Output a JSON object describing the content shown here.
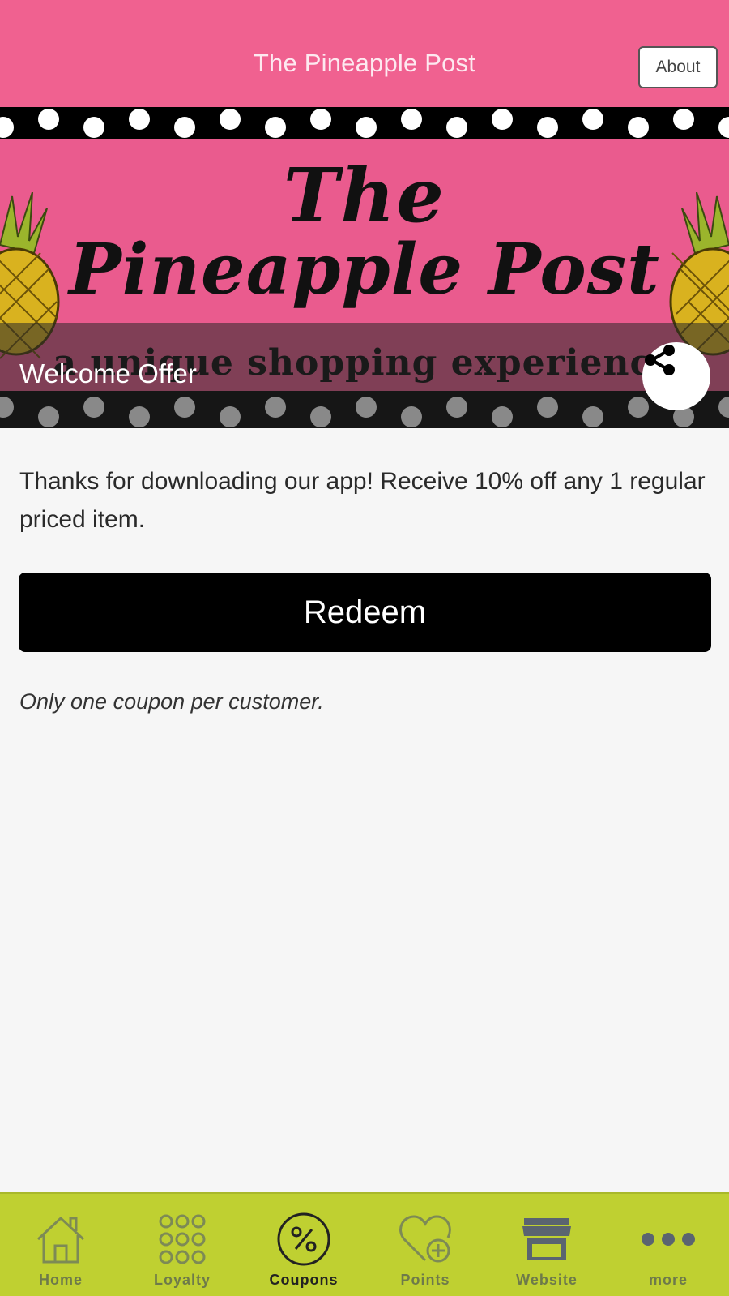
{
  "header": {
    "title": "The Pineapple Post",
    "about_label": "About"
  },
  "banner": {
    "logo_line1": "The",
    "logo_line2": "Pineapple Post",
    "tagline": "a unique shopping experience",
    "offer_title": "Welcome Offer",
    "share_icon": "share-icon"
  },
  "offer": {
    "description": "Thanks for downloading our app! Receive 10% off any 1 regular priced item.",
    "redeem_label": "Redeem",
    "fine_print": "Only one coupon per customer."
  },
  "nav": {
    "items": [
      {
        "label": "Home",
        "icon": "home-icon"
      },
      {
        "label": "Loyalty",
        "icon": "loyalty-icon"
      },
      {
        "label": "Coupons",
        "icon": "coupon-icon",
        "active": true
      },
      {
        "label": "Points",
        "icon": "points-icon"
      },
      {
        "label": "Website",
        "icon": "store-icon"
      },
      {
        "label": "more",
        "icon": "more-icon"
      }
    ]
  },
  "colors": {
    "header_pink": "#f06190",
    "nav_green": "#bfd031",
    "button_black": "#000000"
  }
}
